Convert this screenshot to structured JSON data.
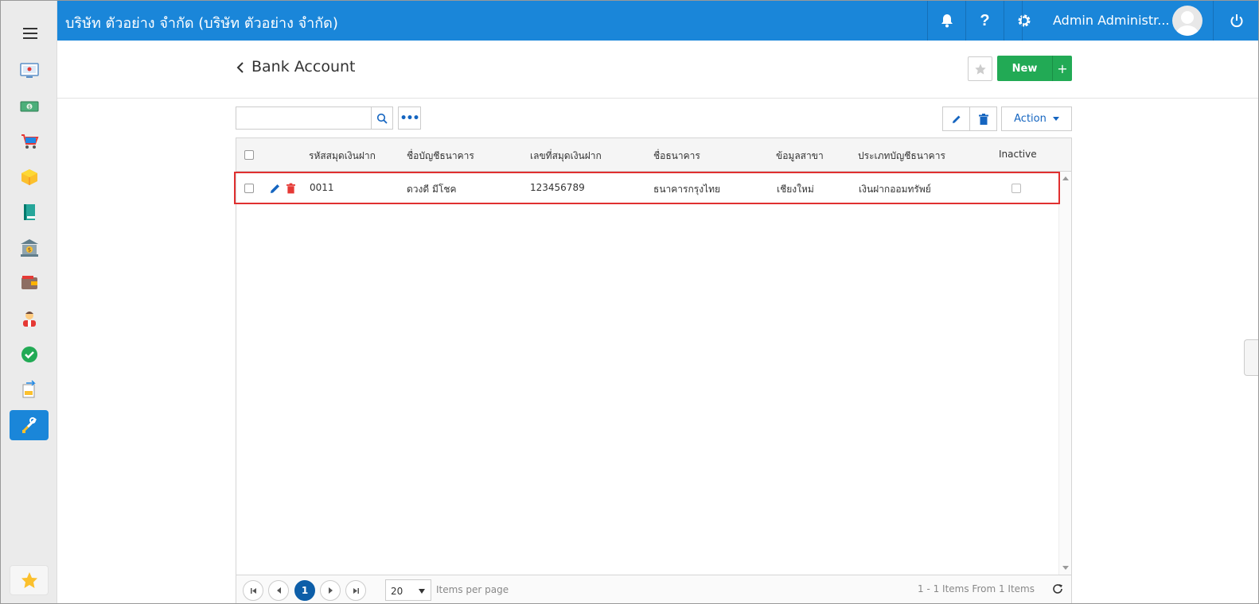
{
  "topbar": {
    "company": "บริษัท ตัวอย่าง จำกัด (บริษัท ตัวอย่าง จำกัด)",
    "user_name": "Admin Administr...",
    "accent": "#1a86d9",
    "icons": [
      "bell-icon",
      "help-icon",
      "gear-icon",
      "avatar",
      "power-icon"
    ]
  },
  "sidebar": {
    "items": [
      "dashboard-icon",
      "money-icon",
      "cart-icon",
      "box-icon",
      "book-icon",
      "bank-icon",
      "wallet-icon",
      "person-icon",
      "check-icon",
      "transfer-icon",
      "tools-icon"
    ],
    "active": "tools-icon",
    "favorite": "star-icon"
  },
  "header": {
    "title": "Bank Account",
    "new_label": "New",
    "new_plus": "+"
  },
  "toolbar": {
    "search_placeholder": "",
    "more_label": "•••",
    "action_label": "Action"
  },
  "grid": {
    "columns": [
      "รหัสสมุดเงินฝาก",
      "ชื่อบัญชีธนาคาร",
      "เลขที่สมุดเงินฝาก",
      "ชื่อธนาคาร",
      "ข้อมูลสาขา",
      "ประเภทบัญชีธนาคาร",
      "Inactive"
    ],
    "rows": [
      {
        "code": "0011",
        "account_name": "ดวงดี มีโชค",
        "book_no": "123456789",
        "bank": "ธนาคารกรุงไทย",
        "branch": "เชียงใหม่",
        "type": "เงินฝากออมทรัพย์",
        "inactive": false
      }
    ]
  },
  "pager": {
    "current_page": "1",
    "page_size": "20",
    "page_size_label": "Items per page",
    "info": "1 - 1 Items From 1 Items"
  }
}
